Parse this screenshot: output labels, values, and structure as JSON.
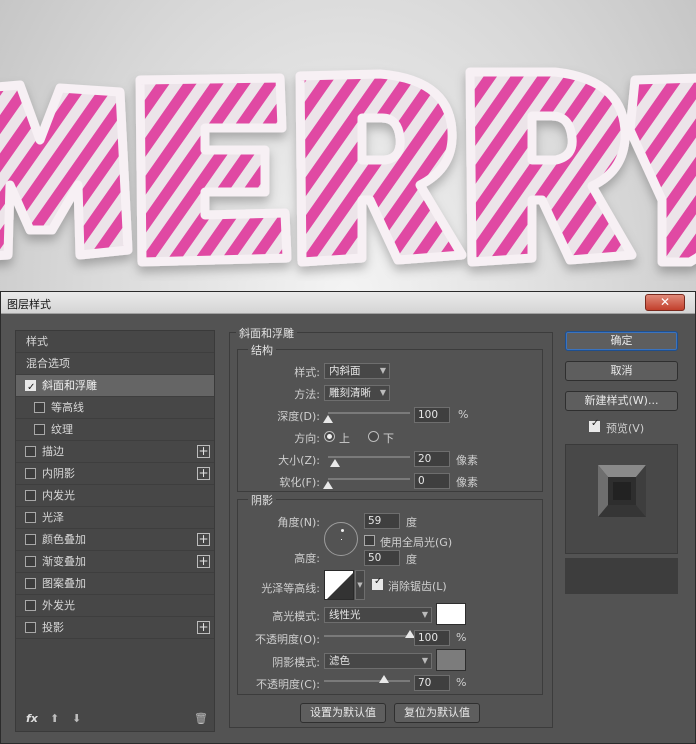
{
  "dialog": {
    "title": "图层样式",
    "close_symbol": "✕"
  },
  "style_list": {
    "items": [
      {
        "label": "样式",
        "checkbox": false,
        "checked": false,
        "plus": false
      },
      {
        "label": "混合选项",
        "checkbox": false,
        "checked": false,
        "plus": false
      },
      {
        "label": "斜面和浮雕",
        "checkbox": true,
        "checked": true,
        "plus": false,
        "selected": true
      },
      {
        "label": "等高线",
        "checkbox": true,
        "checked": false,
        "plus": false,
        "indent": true
      },
      {
        "label": "纹理",
        "checkbox": true,
        "checked": false,
        "plus": false,
        "indent": true
      },
      {
        "label": "描边",
        "checkbox": true,
        "checked": false,
        "plus": true
      },
      {
        "label": "内阴影",
        "checkbox": true,
        "checked": false,
        "plus": true
      },
      {
        "label": "内发光",
        "checkbox": true,
        "checked": false,
        "plus": false
      },
      {
        "label": "光泽",
        "checkbox": true,
        "checked": false,
        "plus": false
      },
      {
        "label": "颜色叠加",
        "checkbox": true,
        "checked": false,
        "plus": true
      },
      {
        "label": "渐变叠加",
        "checkbox": true,
        "checked": false,
        "plus": true
      },
      {
        "label": "图案叠加",
        "checkbox": true,
        "checked": false,
        "plus": false
      },
      {
        "label": "外发光",
        "checkbox": true,
        "checked": false,
        "plus": false
      },
      {
        "label": "投影",
        "checkbox": true,
        "checked": false,
        "plus": true
      }
    ],
    "footer": {
      "fx": "fx",
      "up": "⬆",
      "down": "⬇",
      "trash": "🗑"
    }
  },
  "bevel": {
    "section_title": "斜面和浮雕",
    "structure": {
      "title": "结构",
      "style_label": "样式:",
      "style_value": "内斜面",
      "technique_label": "方法:",
      "technique_value": "雕刻清晰",
      "depth_label": "深度(D):",
      "depth_value": "100",
      "depth_unit": "%",
      "depth_level": 0.0,
      "direction_label": "方向:",
      "dir_up": "上",
      "dir_down": "下",
      "size_label": "大小(Z):",
      "size_value": "20",
      "size_unit": "像素",
      "size_level": 0.08,
      "soften_label": "软化(F):",
      "soften_value": "0",
      "soften_unit": "像素",
      "soften_level": 0.0
    },
    "shading": {
      "title": "阴影",
      "angle_label": "角度(N):",
      "angle_value": "59",
      "angle_unit": "度",
      "global_light_label": "使用全局光(G)",
      "altitude_label": "高度:",
      "altitude_value": "50",
      "altitude_unit": "度",
      "gloss_label": "光泽等高线:",
      "antialias_label": "消除锯齿(L)",
      "highlight_mode_label": "高光模式:",
      "highlight_mode_value": "线性光",
      "highlight_color": "#ffffff",
      "highlight_opacity_label": "不透明度(O):",
      "highlight_opacity_value": "100",
      "highlight_opacity_unit": "%",
      "highlight_opacity_level": 1.0,
      "shadow_mode_label": "阴影模式:",
      "shadow_mode_value": "滤色",
      "shadow_color": "#7c7c7c",
      "shadow_opacity_label": "不透明度(C):",
      "shadow_opacity_value": "70",
      "shadow_opacity_unit": "%",
      "shadow_opacity_level": 0.7
    },
    "set_default": "设置为默认值",
    "reset_default": "复位为默认值"
  },
  "buttons": {
    "ok": "确定",
    "cancel": "取消",
    "new_style": "新建样式(W)...",
    "preview_label": "预览(V)"
  },
  "colors": {
    "candy_pink": "#e84aa8",
    "candy_white": "#f2e9ee",
    "dialog_bg": "#535353"
  }
}
